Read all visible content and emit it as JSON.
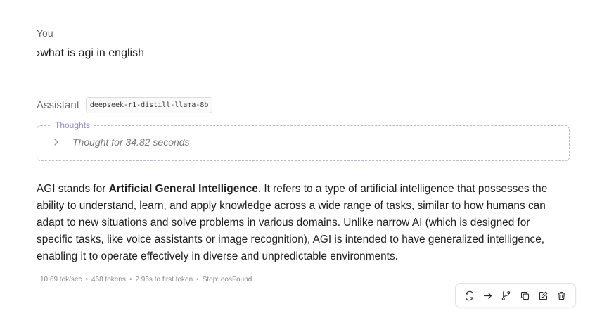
{
  "user": {
    "label": "You",
    "message": "›what is agi in english"
  },
  "assistant": {
    "label": "Assistant",
    "model": "deepseek-r1-distill-llama-8b",
    "thoughts": {
      "legend": "Thoughts",
      "summary": "Thought for 34.82 seconds",
      "collapsed": true
    },
    "answer": {
      "before_bold": "AGI stands for ",
      "bold": "Artificial General Intelligence",
      "after_bold": ". It refers to a type of artificial intelligence that possesses the ability to understand, learn, and apply knowledge across a wide range of tasks, similar to how humans can adapt to new situations and solve problems in various domains. Unlike narrow AI (which is designed for specific tasks, like voice assistants or image recognition), AGI is intended to have generalized intelligence, enabling it to operate effectively in diverse and unpredictable environments."
    },
    "stats": {
      "speed": "10.69 tok/sec",
      "tokens": "468 tokens",
      "first_token": "2.96s to first token",
      "stop": "Stop: eosFound",
      "separator": "•"
    }
  },
  "toolbar": {
    "buttons": [
      {
        "name": "regenerate",
        "icon": "refresh-icon"
      },
      {
        "name": "continue",
        "icon": "arrow-right-icon"
      },
      {
        "name": "branch",
        "icon": "git-branch-icon"
      },
      {
        "name": "copy",
        "icon": "copy-icon"
      },
      {
        "name": "edit",
        "icon": "edit-icon"
      },
      {
        "name": "delete",
        "icon": "trash-icon"
      }
    ]
  },
  "colors": {
    "thoughts_accent": "#8f8bc4",
    "muted_text": "#6b6b6b"
  }
}
